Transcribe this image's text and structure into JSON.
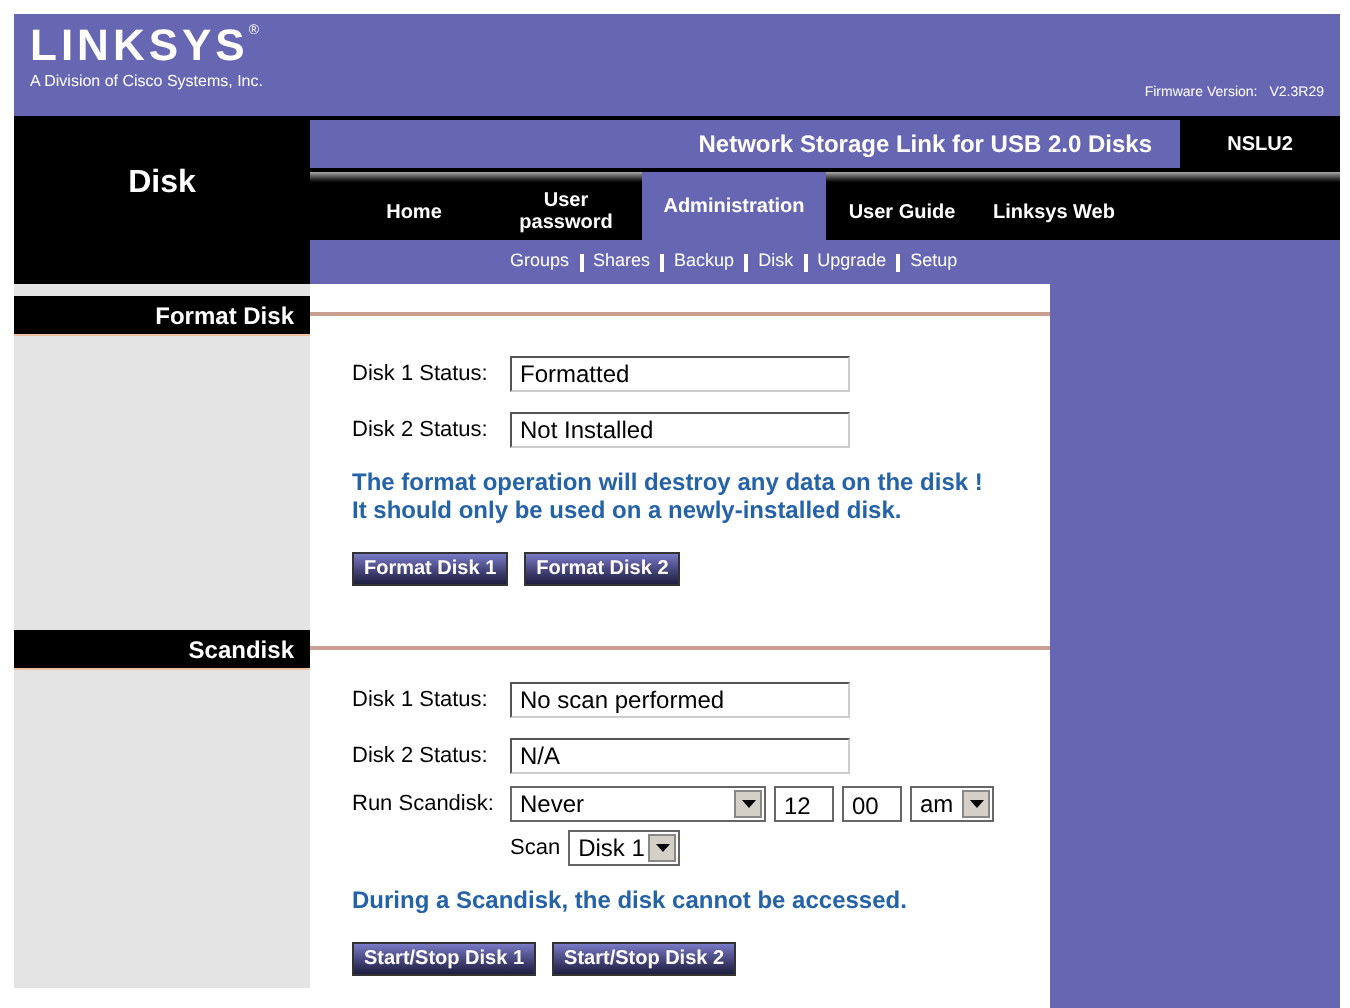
{
  "header": {
    "logo": "LINKSYS",
    "logo_mark": "®",
    "logo_subtitle": "A Division of Cisco Systems, Inc.",
    "firmware_label": "Firmware Version:",
    "firmware_version": "V2.3R29"
  },
  "page_title": "Disk",
  "product_bar": {
    "title": "Network Storage Link for USB 2.0 Disks",
    "model": "NSLU2"
  },
  "nav_tabs": [
    {
      "label": "Home",
      "selected": false
    },
    {
      "label": "User password",
      "selected": false
    },
    {
      "label": "Administration",
      "selected": true
    },
    {
      "label": "User Guide",
      "selected": false
    },
    {
      "label": "Linksys Web",
      "selected": false
    }
  ],
  "sub_nav": [
    "Groups",
    "Shares",
    "Backup",
    "Disk",
    "Upgrade",
    "Setup"
  ],
  "sections": [
    {
      "title": "Format Disk",
      "fields": [
        {
          "label": "Disk 1 Status:",
          "value": "Formatted"
        },
        {
          "label": "Disk 2 Status:",
          "value": "Not Installed"
        }
      ],
      "note": "The format operation will destroy any data on the disk ! It should only be used on a newly-installed disk.",
      "buttons": [
        "Format Disk 1",
        "Format Disk 2"
      ]
    },
    {
      "title": "Scandisk",
      "fields": [
        {
          "label": "Disk 1 Status:",
          "value": "No scan performed"
        },
        {
          "label": "Disk 2 Status:",
          "value": "N/A"
        }
      ],
      "schedule": {
        "label": "Run Scandisk:",
        "frequency": "Never",
        "hour": "12",
        "minute": "00",
        "ampm": "am",
        "scan_label": "Scan",
        "scan_disk": "Disk 1"
      },
      "note": "During a Scandisk, the disk cannot be accessed.",
      "buttons": [
        "Start/Stop Disk 1",
        "Start/Stop Disk 2"
      ]
    }
  ]
}
